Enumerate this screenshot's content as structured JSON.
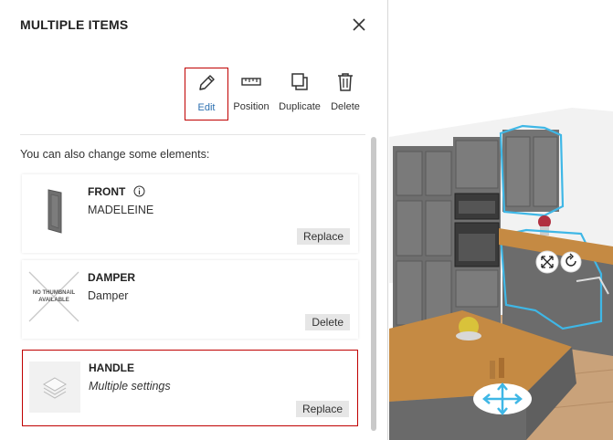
{
  "panel": {
    "title": "MULTIPLE ITEMS",
    "toolbar": {
      "edit_label": "Edit",
      "position_label": "Position",
      "duplicate_label": "Duplicate",
      "delete_label": "Delete"
    },
    "subtitle": "You can also change some elements:",
    "cards": [
      {
        "title": "FRONT",
        "value": "MADELEINE",
        "button": "Replace"
      },
      {
        "title": "DAMPER",
        "value": "Damper",
        "button": "Delete",
        "thumb_text": "NO THUMBNAIL AVAILABLE"
      },
      {
        "title": "HANDLE",
        "value": "Multiple settings",
        "button": "Replace"
      }
    ]
  },
  "icons": {
    "close": "close-icon",
    "edit": "pencil-icon",
    "position": "ruler-icon",
    "duplicate": "duplicate-icon",
    "delete": "trash-icon",
    "info": "info-icon",
    "resize": "resize-icon",
    "rotate": "rotate-icon",
    "move": "move-arrows-icon"
  },
  "colors": {
    "accent": "#2b6fb0",
    "selection_border": "#c00000",
    "selection_outline": "#3fb7e6",
    "button_bg": "#e6e6e6"
  }
}
